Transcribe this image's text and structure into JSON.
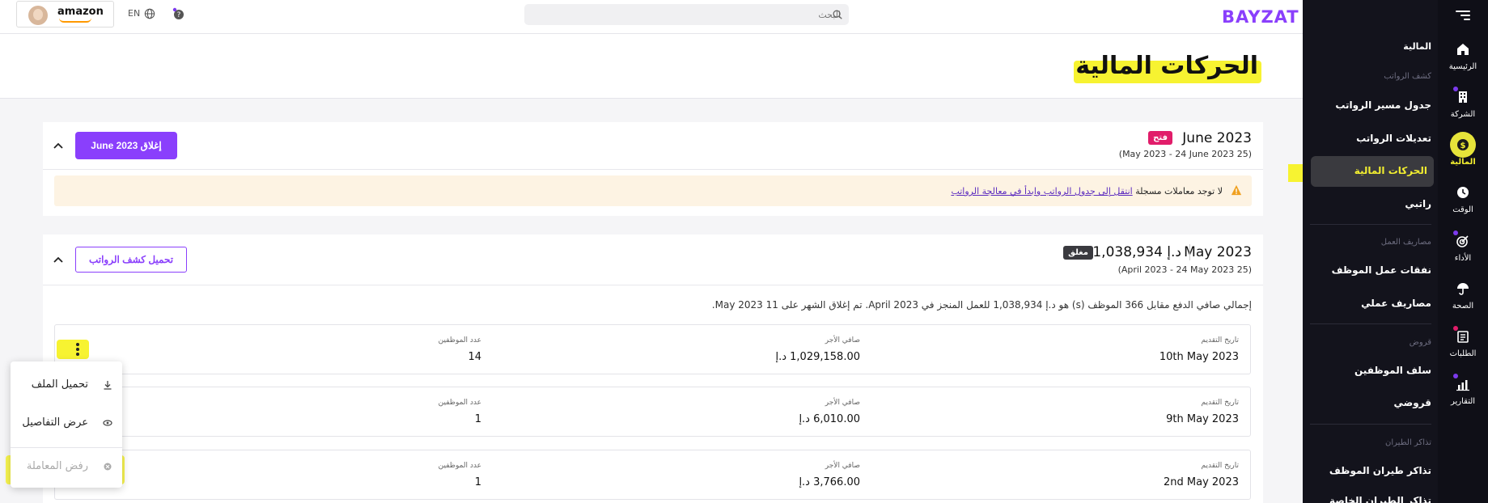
{
  "rail": {
    "items": [
      {
        "label": "الرئيسية",
        "icon": "home-icon"
      },
      {
        "label": "الشركة",
        "icon": "building-icon"
      },
      {
        "label": "المالية",
        "icon": "dollar-icon"
      },
      {
        "label": "الوقت",
        "icon": "clock-icon"
      },
      {
        "label": "الأداء",
        "icon": "target-icon"
      },
      {
        "label": "الصحة",
        "icon": "umbrella-icon"
      },
      {
        "label": "الطلبات",
        "icon": "clipboard-icon"
      },
      {
        "label": "التقارير",
        "icon": "chart-icon"
      }
    ]
  },
  "subnav": {
    "section": "المالية",
    "payroll_group": "كشف الرواتب",
    "payroll_schedule": "جدول مسير الرواتب",
    "payroll_adjustments": "تعديلات الرواتب",
    "financial_transactions": "الحركات المالية",
    "my_salary": "راتبي",
    "expenses_group": "مصاريف العمل",
    "employee_expenses": "نفقات عمل الموظف",
    "my_expenses": "مصاريف عملي",
    "loans_group": "قروض",
    "employee_advances": "سلف الموظفين",
    "my_loans": "قروضي",
    "tickets_group": "تذاكر الطيران",
    "employee_tickets": "تذاكر طيران الموظف",
    "my_tickets": "تذاكر الطيران الخاصة"
  },
  "topbar": {
    "logo": "BAYZAT",
    "search_placeholder": "البحث",
    "company": "amazon",
    "lang": "EN"
  },
  "page": {
    "title": "الحركات المالية"
  },
  "june": {
    "title": "June 2023",
    "status": "فتح",
    "range": "(25 May 2023 - 24 June 2023)",
    "close_button": "إغلاق June 2023",
    "notice_text": "لا توجد معاملات مسجلة",
    "notice_link": "انتقل إلى جدول الرواتب وابدأ في معالجة الرواتب"
  },
  "may": {
    "title": "May 2023",
    "amount": "د.إ 1,038,934",
    "status": "مغلق",
    "range": "(25 April 2023 - 24 May 2023)",
    "download_button": "تحميل كشف الرواتب",
    "summary": "إجمالي صافي الدفع مقابل 366 الموظف (s) هو د.إ 1,038,934 للعمل المنجز في April 2023. تم إغلاق الشهر على 11 May 2023."
  },
  "columns": {
    "date": "تاريخ التقديم",
    "net": "صافي الأجر",
    "count": "عدد الموظفين"
  },
  "rows": [
    {
      "date": "10th May 2023",
      "net": "1,029,158.00 د.إ",
      "count": "14"
    },
    {
      "date": "9th May 2023",
      "net": "6,010.00 د.إ",
      "count": "1"
    },
    {
      "date": "2nd May 2023",
      "net": "3,766.00 د.إ",
      "count": "1"
    }
  ],
  "menu": {
    "download": "تحميل الملف",
    "details": "عرض التفاصيل",
    "reject": "رفض المعاملة"
  },
  "colors": {
    "accent": "#8a3ffc",
    "highlight": "#f7f331",
    "open_badge": "#e11d6a",
    "sidebar": "#0f0f17"
  }
}
